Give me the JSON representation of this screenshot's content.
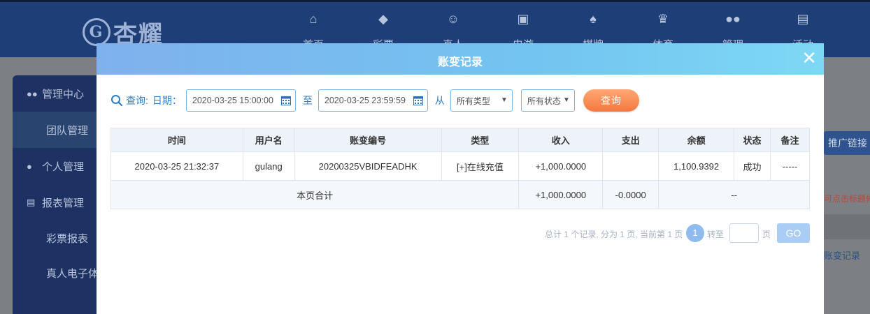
{
  "site": {
    "logo_text": "杏耀",
    "nav": [
      {
        "label": "首页",
        "icon": "home-icon"
      },
      {
        "label": "彩票",
        "icon": "lottery-icon"
      },
      {
        "label": "真人",
        "icon": "live-dealer-icon"
      },
      {
        "label": "电游",
        "icon": "slot-game-icon"
      },
      {
        "label": "棋牌",
        "icon": "chess-card-icon"
      },
      {
        "label": "体育",
        "icon": "trophy-icon"
      },
      {
        "label": "管理",
        "icon": "users-icon"
      },
      {
        "label": "活动",
        "icon": "gift-icon"
      }
    ],
    "sidebar": {
      "items": [
        {
          "label": "管理中心",
          "icon": "users-icon"
        },
        {
          "label": "团队管理"
        },
        {
          "label": "个人管理",
          "icon": "user-icon"
        },
        {
          "label": "报表管理",
          "icon": "report-icon"
        },
        {
          "label": "彩票报表"
        },
        {
          "label": "真人电子体"
        }
      ]
    },
    "right": {
      "promo_label": "推广链接",
      "tip_text": "可点击标题修改",
      "link_text": "账变记录"
    }
  },
  "modal": {
    "title": "账变记录",
    "close_icon": "close-icon",
    "query": {
      "label": "查询:",
      "date_label": "日期：",
      "start_date": "2020-03-25 15:00:00",
      "to_label": "至",
      "end_date": "2020-03-25 23:59:59",
      "from_label": "从",
      "type_select": "所有类型",
      "status_select": "所有状态",
      "search_button": "查询"
    },
    "table": {
      "headers": [
        "时间",
        "用户名",
        "账变编号",
        "类型",
        "收入",
        "支出",
        "余额",
        "状态",
        "备注"
      ],
      "rows": [
        {
          "time": "2020-03-25 21:32:37",
          "username": "gulang",
          "txn_id": "20200325VBIDFEADHK",
          "type": "[+]在线充值",
          "income": "+1,000.0000",
          "expense": "",
          "balance": "1,100.9392",
          "status": "成功",
          "note": "-----"
        }
      ],
      "total": {
        "label": "本页合计",
        "income": "+1,000.0000",
        "expense": "-0.0000",
        "balance": "--"
      }
    },
    "pager": {
      "info": "总计 1 个记录, 分为 1 页, 当前第 1 页",
      "current_page": "1",
      "goto_label": "转至",
      "page_unit": "页",
      "go_button": "GO",
      "page_input": ""
    },
    "colors": {
      "header_gradient_start": "#7fb1ee",
      "header_gradient_end": "#7dd8f5",
      "accent_blue": "#2f7dc7",
      "search_button": "#f4783f",
      "income_green": "#3b9a1a"
    }
  }
}
